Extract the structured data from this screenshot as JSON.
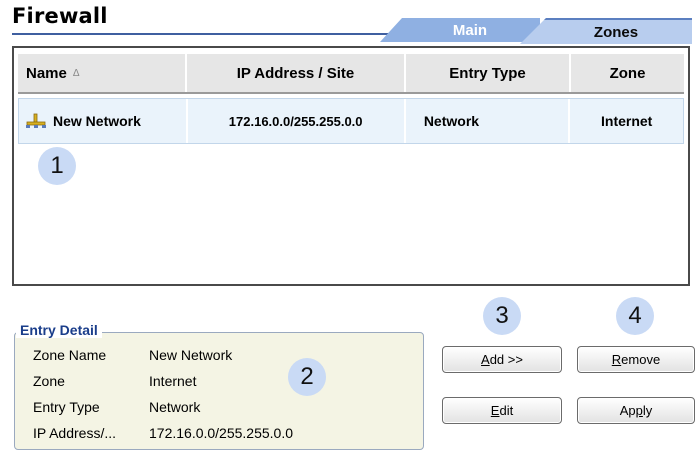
{
  "window": {
    "title": "Firewall"
  },
  "tabs": [
    {
      "label": "Main",
      "active": false
    },
    {
      "label": "Zones",
      "active": true
    }
  ],
  "table": {
    "columns": [
      "Name",
      "IP Address / Site",
      "Entry Type",
      "Zone"
    ],
    "sort_indicator": "Δ",
    "rows": [
      {
        "name": "New Network",
        "ip": "172.16.0.0/255.255.0.0",
        "type": "Network",
        "zone": "Internet",
        "icon": "network-icon"
      }
    ]
  },
  "detail": {
    "legend": "Entry Detail",
    "fields": [
      {
        "key": "Zone Name",
        "value": "New Network"
      },
      {
        "key": "Zone",
        "value": "Internet"
      },
      {
        "key": "Entry Type",
        "value": "Network"
      },
      {
        "key": "IP Address/...",
        "value": "172.16.0.0/255.255.0.0"
      }
    ]
  },
  "buttons": {
    "add": {
      "mnemonic": "A",
      "rest": "dd >>"
    },
    "remove": {
      "mnemonic": "R",
      "rest": "emove"
    },
    "edit": {
      "mnemonic": "E",
      "rest": "dit"
    },
    "apply": {
      "prefix": "Ap",
      "mnemonic": "p",
      "rest": "ly"
    }
  },
  "callouts": [
    "1",
    "2",
    "3",
    "4"
  ],
  "colors": {
    "accent": "#3f5fa0",
    "callout": "#c9daf5",
    "row_selected": "#eaf3fb",
    "detail_bg": "#f4f4e4",
    "legend_text": "#1a3d8a"
  }
}
